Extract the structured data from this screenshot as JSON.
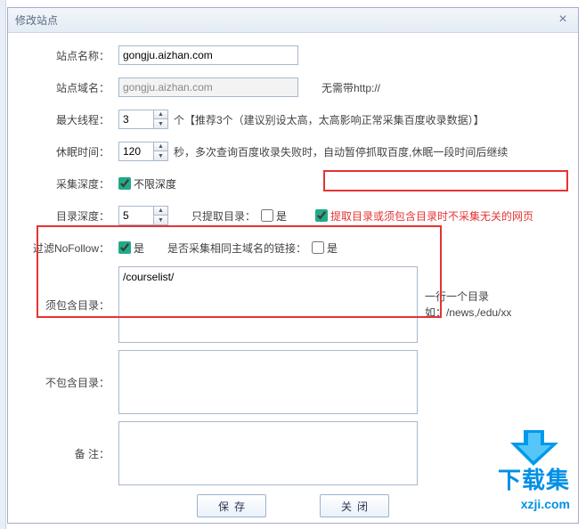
{
  "dialog": {
    "title": "修改站点",
    "close_glyph": "×"
  },
  "labels": {
    "site_name": "站点名称：",
    "site_domain": "站点域名：",
    "max_threads": "最大线程：",
    "sleep_time": "休眠时间：",
    "crawl_depth": "采集深度：",
    "dir_depth": "目录深度：",
    "filter_nofollow": "过滤NoFollow：",
    "must_include_dir": "须包含目录：",
    "exclude_dir": "不包含目录：",
    "remark": "备   注："
  },
  "values": {
    "site_name": "gongju.aizhan.com",
    "site_domain": "gongju.aizhan.com",
    "max_threads": "3",
    "sleep_time": "120",
    "dir_depth": "5",
    "must_include_dir": "/courselist/",
    "exclude_dir": "",
    "remark": ""
  },
  "hints": {
    "no_http": "无需带http://",
    "threads_hint": "个【推荐3个（建议别设太高，太高影响正常采集百度收录数据）】",
    "sleep_hint": "秒，多次查询百度收录失败时，自动暂停抓取百度,休眠一段时间后继续",
    "depth_unlimited": "不限深度",
    "extract_dir_only_label": "只提取目录：",
    "extract_dir_only_yes": "是",
    "dir_highlight": "提取目录或须包含目录时不采集无关的网页",
    "nofollow_yes": "是",
    "same_domain_label": "是否采集相同主域名的链接：",
    "same_domain_yes": "是",
    "dir_side_hint_1": "一行一个目录",
    "dir_side_hint_2": "如：/news,/edu/xx"
  },
  "buttons": {
    "save": "保存",
    "close": "关闭"
  },
  "watermark": {
    "brand": "下载集",
    "url": "xzji.com"
  },
  "icons": {
    "spin_up": "▲",
    "spin_down": "▼"
  }
}
